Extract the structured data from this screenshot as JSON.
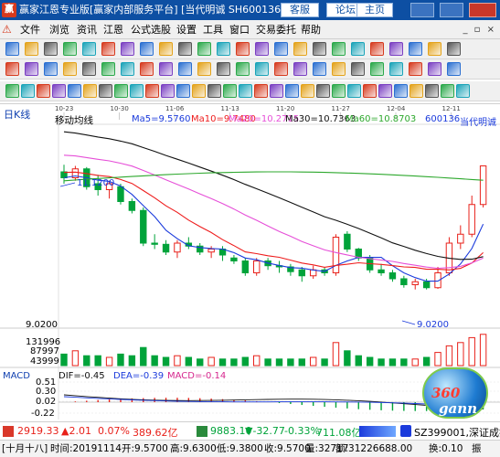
{
  "window": {
    "title": "赢家江恩专业版[赢家内部服务平台] [当代明诚  SH600136-38日K线",
    "btn_forum_main": "客服",
    "btn_forum": "论坛",
    "btn_home": "主页"
  },
  "menu": [
    "文件",
    "浏览",
    "资讯",
    "江恩",
    "公式选股",
    "设置",
    "工具",
    "窗口",
    "交易委托",
    "帮助"
  ],
  "chart": {
    "period_label": "日K线",
    "indicator_name": "移动均线",
    "ma5": "Ma5=9.5760",
    "ma10": "Ma10=9.7480",
    "ma20": "Ma20=10.2715",
    "ma30": "Ma30=10.7363",
    "ma60": "Ma60=10.8703",
    "stock_code": "600136",
    "stock_name": "当代明诚",
    "date_ticks": [
      "10-23",
      "10-30",
      "11-06",
      "11-13",
      "11-20",
      "11-27",
      "12-04",
      "12-11"
    ],
    "high_mark": "11.1200",
    "low_mark": "9.0200",
    "price_axis_low": "9.0200",
    "vol_ticks": [
      "131996",
      "87997",
      "43999"
    ],
    "macd_label": "MACD",
    "dif": "DIF=-0.45",
    "dea": "DEA=-0.39",
    "macd": "MACD=-0.14",
    "macd_ticks": [
      "0.51",
      "0.30",
      "0.02",
      "-0.22"
    ],
    "colors": {
      "up": "#e8211a",
      "down": "#00a33a",
      "ma5": "#1b3bdc",
      "ma10": "#ee1c1c",
      "ma20": "#e64fd8",
      "ma30": "#111111",
      "ma60": "#2da82d",
      "bg": "#ffffff"
    }
  },
  "status": {
    "sh_index": "2919.33",
    "sh_change": "▲2.01",
    "sh_pct": "0.07%",
    "sh_amount": "389.62亿",
    "sz_index": "9883.10",
    "sz_change": "▼-32.77",
    "sz_pct": "-0.33%",
    "sz_amount": "711.08亿",
    "right_index": "SZ399001,深证成指"
  },
  "bottom": {
    "bracket": "[十月十八]",
    "time": "时间:20191114",
    "open": "开:9.5700",
    "high": "高:9.6300",
    "low": "低:9.3800",
    "close": "收:9.5700",
    "volume": "量:32717",
    "amount": "额:31226688.00",
    "turnover": "换:0.10",
    "more": "振"
  },
  "logo": {
    "text": "gann",
    "num": "360"
  }
}
